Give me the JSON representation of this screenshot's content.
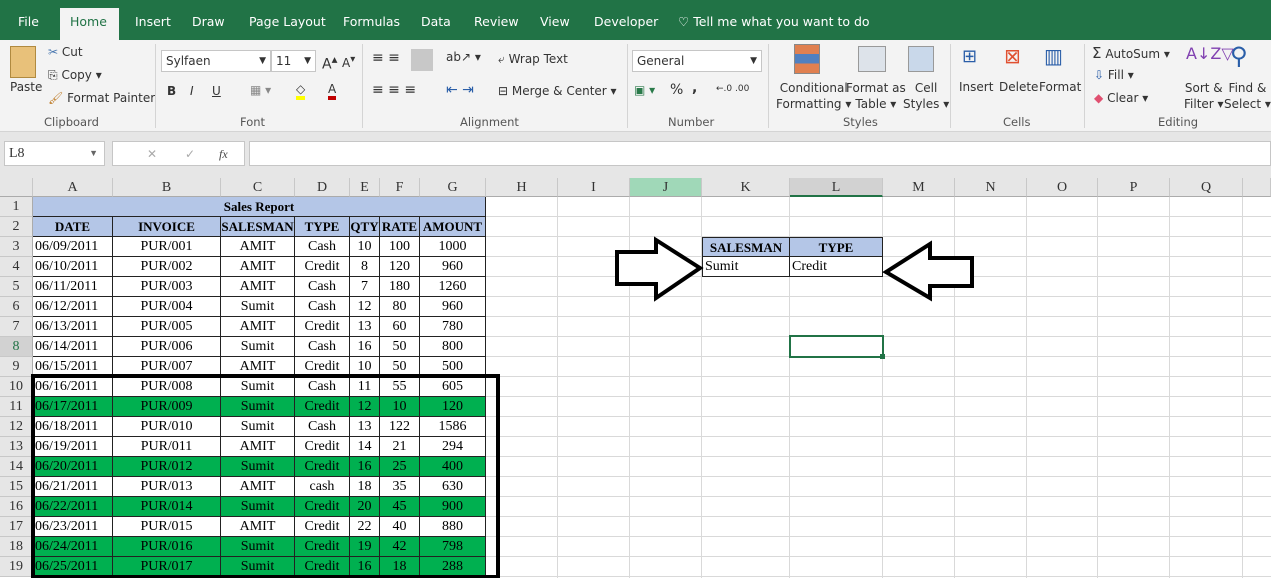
{
  "tabs": [
    "File",
    "Home",
    "Insert",
    "Draw",
    "Page Layout",
    "Formulas",
    "Data",
    "Review",
    "View",
    "Developer"
  ],
  "tell_me": "Tell me what you want to do",
  "clipboard": {
    "paste": "Paste",
    "cut": "Cut",
    "copy": "Copy",
    "format_painter": "Format Painter",
    "label": "Clipboard"
  },
  "font": {
    "name": "Sylfaen",
    "size": "11",
    "bold": "B",
    "italic": "I",
    "underline": "U",
    "label": "Font"
  },
  "alignment": {
    "wrap": "Wrap Text",
    "merge": "Merge & Center",
    "label": "Alignment"
  },
  "number": {
    "format": "General",
    "percent": "%",
    "comma": ",",
    "label": "Number"
  },
  "styles": {
    "conditional": [
      "Conditional",
      "Formatting ▾"
    ],
    "format_table": [
      "Format as",
      "Table ▾"
    ],
    "cell_styles": [
      "Cell",
      "Styles ▾"
    ],
    "label": "Styles"
  },
  "cells": {
    "insert": "Insert",
    "delete": "Delete",
    "format": "Format",
    "label": "Cells"
  },
  "editing": {
    "autosum": "AutoSum",
    "fill": "Fill",
    "clear": "Clear",
    "sort": [
      "Sort &",
      "Filter ▾"
    ],
    "find": [
      "Find &",
      "Select ▾"
    ],
    "label": "Editing"
  },
  "formula_bar": {
    "name_box": "L8",
    "cancel": "✕",
    "enter": "✓",
    "fx": "fx",
    "value": ""
  },
  "columns": [
    "A",
    "B",
    "C",
    "D",
    "E",
    "F",
    "G",
    "H",
    "I",
    "J",
    "K",
    "L",
    "M",
    "N",
    "O",
    "P",
    "Q"
  ],
  "rows": [
    "1",
    "2",
    "3",
    "4",
    "5",
    "6",
    "7",
    "8",
    "9",
    "10",
    "11",
    "12",
    "13",
    "14",
    "15",
    "16",
    "17",
    "18",
    "19"
  ],
  "active_cell": "L8",
  "colors": {
    "highlight": "#00b050",
    "header": "#b4c6e7",
    "excel_green": "#217346"
  },
  "report": {
    "title": "Sales Report",
    "headers": [
      "DATE",
      "INVOICE",
      "SALESMAN",
      "TYPE",
      "QTY",
      "RATE",
      "AMOUNT"
    ],
    "rows": [
      {
        "cells": [
          "06/09/2011",
          "PUR/001",
          "AMIT",
          "Cash",
          "10",
          "100",
          "1000"
        ],
        "highlight": false
      },
      {
        "cells": [
          "06/10/2011",
          "PUR/002",
          "AMIT",
          "Credit",
          "8",
          "120",
          "960"
        ],
        "highlight": false
      },
      {
        "cells": [
          "06/11/2011",
          "PUR/003",
          "AMIT",
          "Cash",
          "7",
          "180",
          "1260"
        ],
        "highlight": false
      },
      {
        "cells": [
          "06/12/2011",
          "PUR/004",
          "Sumit",
          "Cash",
          "12",
          "80",
          "960"
        ],
        "highlight": false
      },
      {
        "cells": [
          "06/13/2011",
          "PUR/005",
          "AMIT",
          "Credit",
          "13",
          "60",
          "780"
        ],
        "highlight": false
      },
      {
        "cells": [
          "06/14/2011",
          "PUR/006",
          "Sumit",
          "Cash",
          "16",
          "50",
          "800"
        ],
        "highlight": false
      },
      {
        "cells": [
          "06/15/2011",
          "PUR/007",
          "AMIT",
          "Credit",
          "10",
          "50",
          "500"
        ],
        "highlight": false
      },
      {
        "cells": [
          "06/16/2011",
          "PUR/008",
          "Sumit",
          "Cash",
          "11",
          "55",
          "605"
        ],
        "highlight": false
      },
      {
        "cells": [
          "06/17/2011",
          "PUR/009",
          "Sumit",
          "Credit",
          "12",
          "10",
          "120"
        ],
        "highlight": true
      },
      {
        "cells": [
          "06/18/2011",
          "PUR/010",
          "Sumit",
          "Cash",
          "13",
          "122",
          "1586"
        ],
        "highlight": false
      },
      {
        "cells": [
          "06/19/2011",
          "PUR/011",
          "AMIT",
          "Credit",
          "14",
          "21",
          "294"
        ],
        "highlight": false
      },
      {
        "cells": [
          "06/20/2011",
          "PUR/012",
          "Sumit",
          "Credit",
          "16",
          "25",
          "400"
        ],
        "highlight": true
      },
      {
        "cells": [
          "06/21/2011",
          "PUR/013",
          "AMIT",
          "cash",
          "18",
          "35",
          "630"
        ],
        "highlight": false
      },
      {
        "cells": [
          "06/22/2011",
          "PUR/014",
          "Sumit",
          "Credit",
          "20",
          "45",
          "900"
        ],
        "highlight": true
      },
      {
        "cells": [
          "06/23/2011",
          "PUR/015",
          "AMIT",
          "Credit",
          "22",
          "40",
          "880"
        ],
        "highlight": false
      },
      {
        "cells": [
          "06/24/2011",
          "PUR/016",
          "Sumit",
          "Credit",
          "19",
          "42",
          "798"
        ],
        "highlight": true
      },
      {
        "cells": [
          "06/25/2011",
          "PUR/017",
          "Sumit",
          "Credit",
          "16",
          "18",
          "288"
        ],
        "highlight": true
      }
    ]
  },
  "criteria": {
    "headers": [
      "SALESMAN",
      "TYPE"
    ],
    "values": [
      "Sumit",
      "Credit"
    ]
  }
}
